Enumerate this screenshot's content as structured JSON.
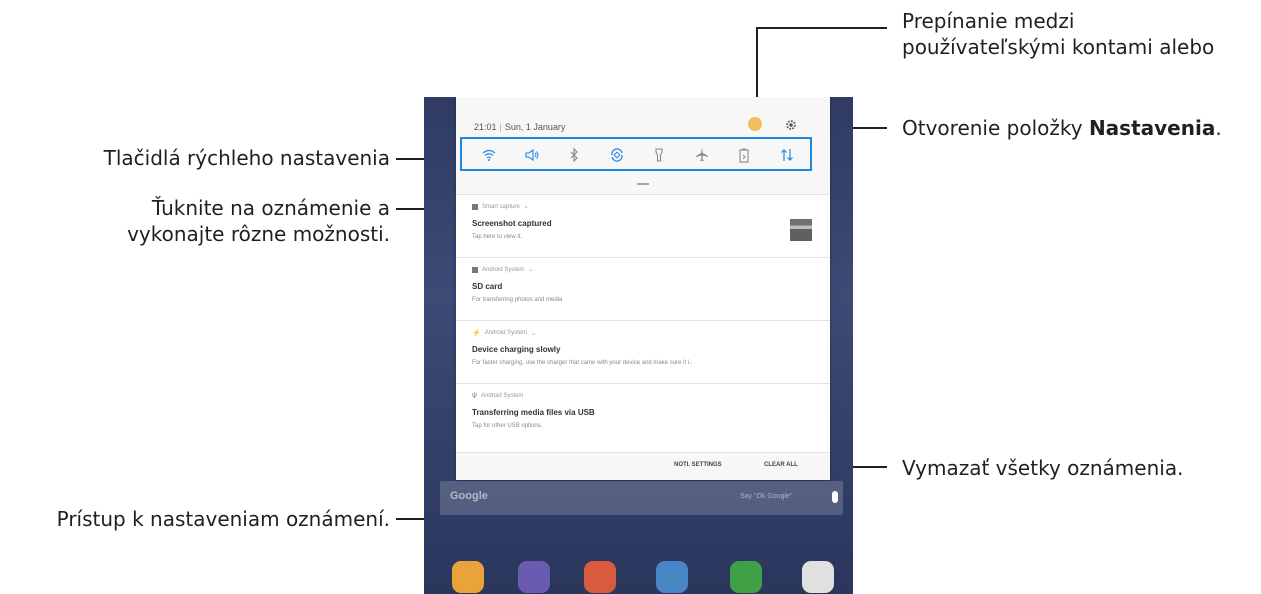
{
  "callouts": {
    "user_switch": [
      "Prepínanie medzi",
      "používateľskými kontami alebo"
    ],
    "settings_prefix": "Otvorenie položky ",
    "settings_bold": "Nastavenia",
    "settings_suffix": ".",
    "quick_settings": "Tlačidlá rýchleho nastavenia",
    "tap_notification": [
      "Ťuknite na oznámenie a",
      "vykonajte rôzne možnosti."
    ],
    "clear_all": "Vymazať všetky oznámenia.",
    "notif_settings": "Prístup k nastaveniam oznámení."
  },
  "status": {
    "time": "21:01",
    "date": "Sun, 1 January"
  },
  "quick_settings": [
    "wifi-icon",
    "sound-icon",
    "bluetooth-icon",
    "auto-rotate-icon",
    "flashlight-icon",
    "airplane-mode-icon",
    "power-saving-icon",
    "mobile-data-icon"
  ],
  "notifications": [
    {
      "app": "Smart capture",
      "title": "Screenshot captured",
      "text": "Tap here to view it.",
      "has_thumb": true
    },
    {
      "app": "Android System",
      "title": "SD card",
      "text": "For transferring photos and media"
    },
    {
      "app": "Android System",
      "title": "Device charging slowly",
      "text": "For faster charging, use the charger that came with your device and make sure it i.."
    },
    {
      "app": "Android System",
      "title": "Transferring media files via USB",
      "text": "Tap for other USB options."
    }
  ],
  "footer": {
    "noti_settings": "NOTI. SETTINGS",
    "clear_all": "CLEAR ALL"
  },
  "google": {
    "word": "Google",
    "hint": "Say \"Ok Google\""
  },
  "dock_colors": [
    "#e8a33b",
    "#6a5bb0",
    "#d95a3c",
    "#4a86c6",
    "#3fa046",
    "#e0e0e0"
  ],
  "accent": "#1e88e5"
}
